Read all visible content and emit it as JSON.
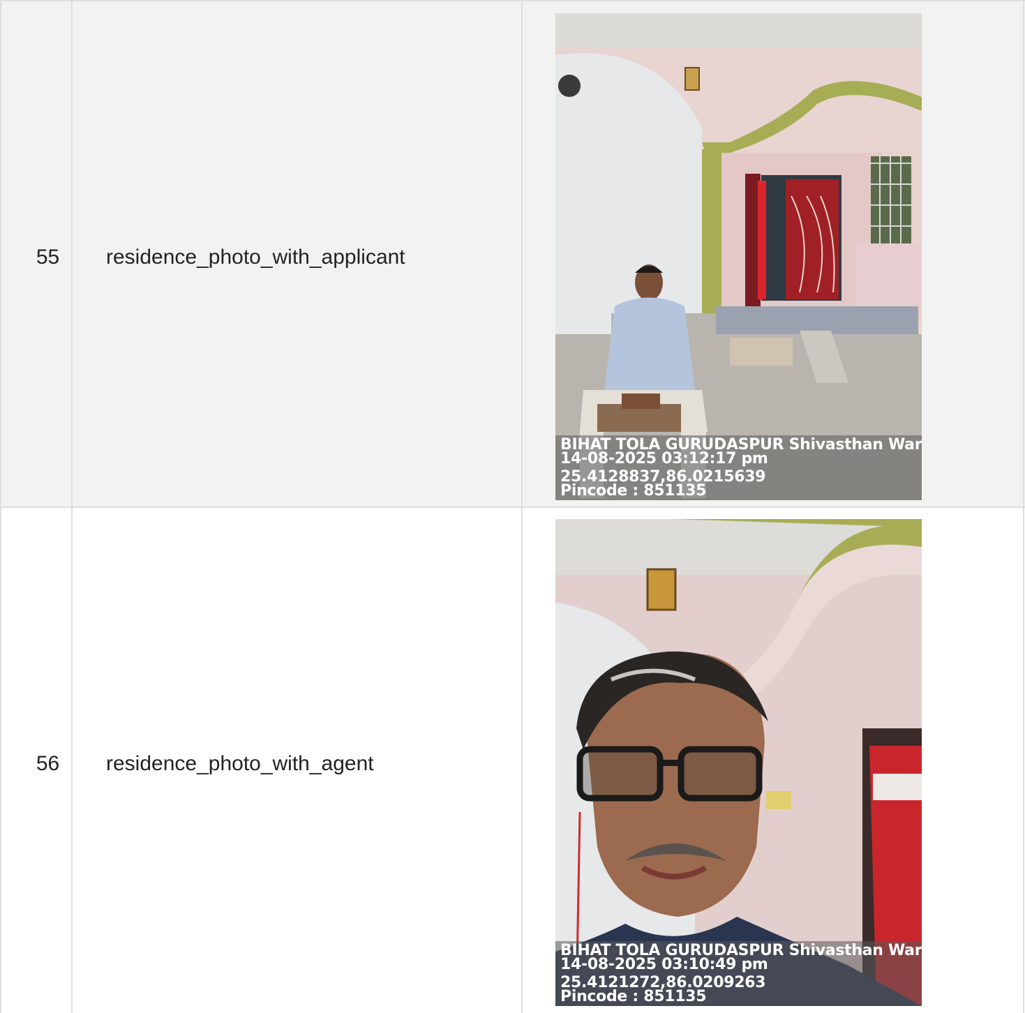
{
  "rows": [
    {
      "serial": "55",
      "field": "residence_photo_with_applicant",
      "photo": {
        "subject": "house-entrance-with-seated-applicant",
        "stamp": {
          "address": "BIHAT TOLA GURUDASPUR Shivasthan Warc",
          "datetime": "14-08-2025 03:12:17 pm",
          "coordinates": "25.4128837,86.0215639",
          "pincode": "Pincode : 851135"
        }
      }
    },
    {
      "serial": "56",
      "field": "residence_photo_with_agent",
      "photo": {
        "subject": "agent-selfie-at-house",
        "stamp": {
          "address": "BIHAT TOLA GURUDASPUR Shivasthan Warc",
          "datetime": "14-08-2025 03:10:49 pm",
          "coordinates": "25.4121272,86.0209263",
          "pincode": "Pincode : 851135"
        }
      }
    }
  ],
  "colors": {
    "grid_line": "#dedede",
    "row_odd_bg": "#f2f2f2",
    "row_even_bg": "#ffffff",
    "text": "#222222"
  }
}
